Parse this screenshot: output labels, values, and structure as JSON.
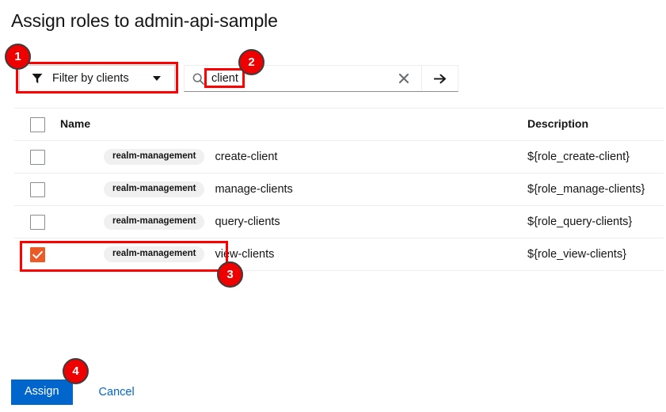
{
  "page": {
    "title": "Assign roles to admin-api-sample"
  },
  "toolbar": {
    "filter": {
      "icon": "funnel-icon",
      "label": "Filter by clients",
      "caret_icon": "caret-down-icon"
    },
    "search": {
      "icon": "search-icon",
      "value": "client",
      "placeholder": "Search",
      "clear_icon": "times-icon",
      "submit_icon": "arrow-right-icon"
    }
  },
  "table": {
    "columns": [
      "Name",
      "Description"
    ],
    "rows": [
      {
        "checked": false,
        "client": "realm-management",
        "name": "create-client",
        "description": "${role_create-client}"
      },
      {
        "checked": false,
        "client": "realm-management",
        "name": "manage-clients",
        "description": "${role_manage-clients}"
      },
      {
        "checked": false,
        "client": "realm-management",
        "name": "query-clients",
        "description": "${role_query-clients}"
      },
      {
        "checked": true,
        "client": "realm-management",
        "name": "view-clients",
        "description": "${role_view-clients}"
      }
    ]
  },
  "footer": {
    "assign_label": "Assign",
    "cancel_label": "Cancel"
  },
  "annotations": {
    "badges": [
      {
        "number": "1"
      },
      {
        "number": "2"
      },
      {
        "number": "3"
      },
      {
        "number": "4"
      }
    ]
  },
  "colors": {
    "primary_button": "#0066cc",
    "link": "#0066cc",
    "checkbox_checked": "#ec5b27",
    "annotation": "#ff0000",
    "pill_background": "#f0f0f0"
  }
}
